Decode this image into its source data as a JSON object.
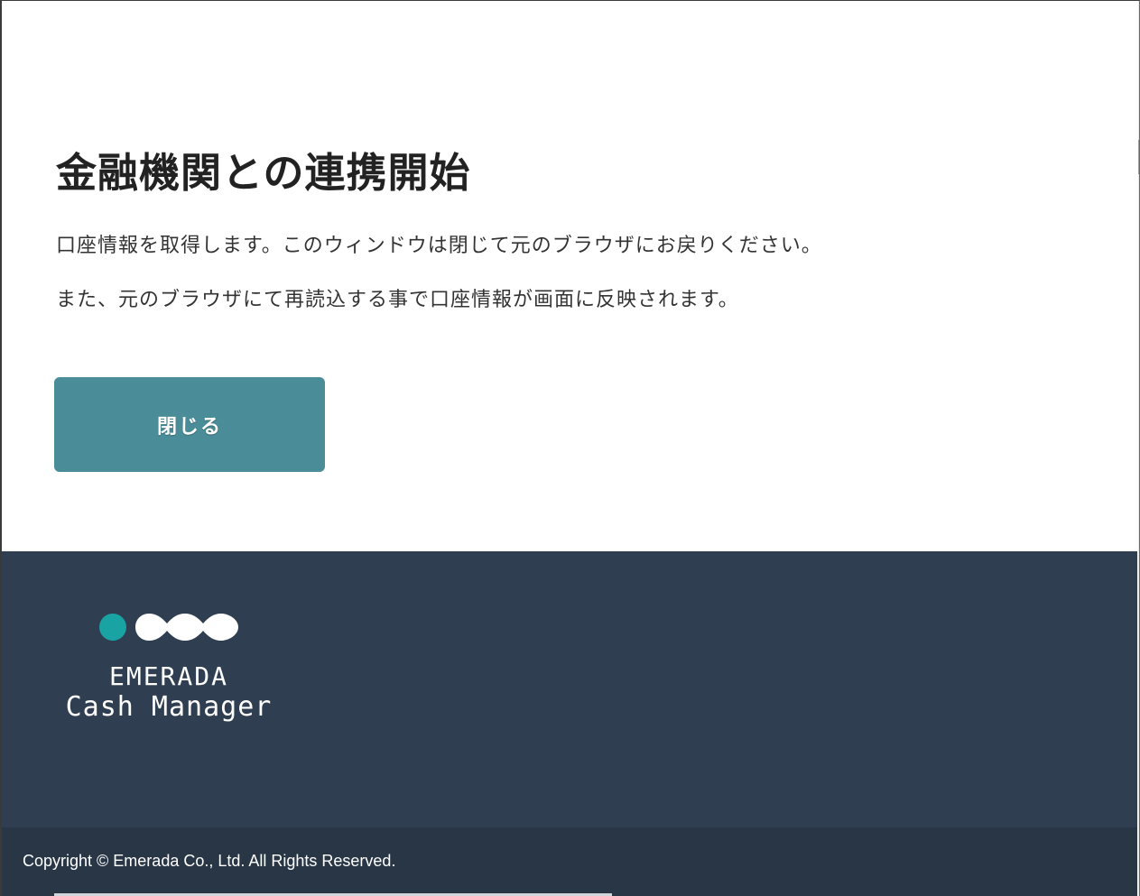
{
  "main": {
    "title": "金融機関との連携開始",
    "message_line1": "口座情報を取得します。このウィンドウは閉じて元のブラウザにお戻りください。",
    "message_line2": "また、元のブラウザにて再読込する事で口座情報が画面に反映されます。",
    "close_label": "閉じる"
  },
  "footer": {
    "logo_line1": "EMERADA",
    "logo_line2": "Cash Manager",
    "copyright": "Copyright © Emerada Co., Ltd. All Rights Reserved."
  },
  "colors": {
    "button": "#4a8c98",
    "footer_bg": "#2f3e50",
    "bottom_bar_bg": "#283646",
    "logo_accent": "#1aa3a3"
  },
  "icons": {
    "logo": "emerada-dots-logo-icon"
  }
}
